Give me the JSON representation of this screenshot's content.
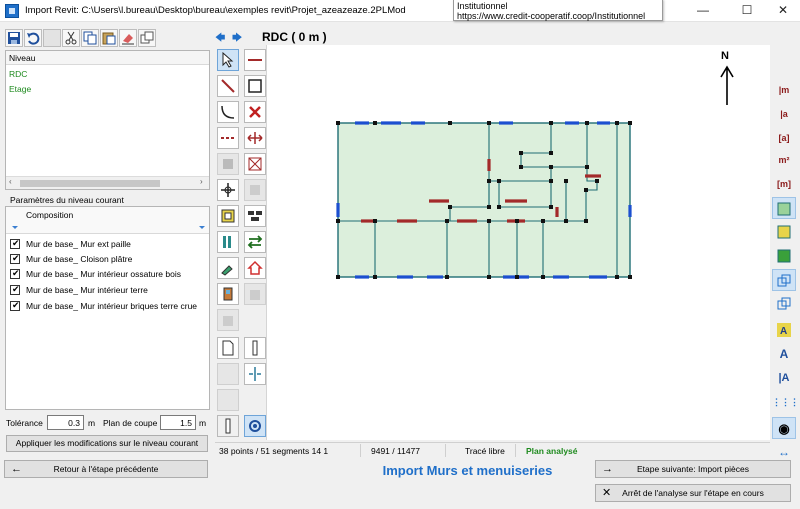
{
  "window": {
    "title": "Import Revit: C:\\Users\\l.bureau\\Desktop\\bureau\\exemples revit\\Projet_azeazeaze.2PLMod",
    "tooltip_line1": "Institutionnel",
    "tooltip_line2": "https://www.credit-cooperatif.coop/Institutionnel",
    "minimize": "—",
    "maximize": "☐",
    "close": "✕"
  },
  "levels": {
    "header": "Niveau",
    "items": [
      "RDC",
      "Etage"
    ]
  },
  "params": {
    "label": "Paramètres du niveau courant",
    "column": "Composition",
    "rows": [
      "Mur de base_ Mur ext paille",
      "Mur de base_ Cloison plâtre",
      "Mur de base_ Mur intérieur ossature bois",
      "Mur de base_ Mur intérieur terre",
      "Mur de base_ Mur intérieur briques terre crue"
    ]
  },
  "settings": {
    "tolerance_label": "Tolérance",
    "tolerance_value": "0.3",
    "tolerance_unit": "m",
    "cut_label": "Plan de coupe",
    "cut_value": "1.5",
    "cut_unit": "m",
    "apply_label": "Appliquer les modifications sur le niveau courant"
  },
  "canvas": {
    "level_title": "RDC ( 0 m )",
    "north": "N"
  },
  "status": {
    "points": "38 points / 51 segments 14 1",
    "coords": "9491 / 11477",
    "mode": "Tracé libre",
    "state": "Plan analysé"
  },
  "footer": {
    "back_label": "Retour à l'étape précédente",
    "title": "Import Murs et menuiseries",
    "next_label": "Etape suivante: Import pièces",
    "stop_label": "Arrêt de l'analyse sur l'étape en cours"
  },
  "colors": {
    "accent": "#1f6fc9",
    "level_green": "#1e8a1e",
    "room_fill": "#dcefdc",
    "wall_teal": "#1f6e74",
    "door_red": "#a32a2a",
    "window_blue": "#1c4fd0"
  }
}
